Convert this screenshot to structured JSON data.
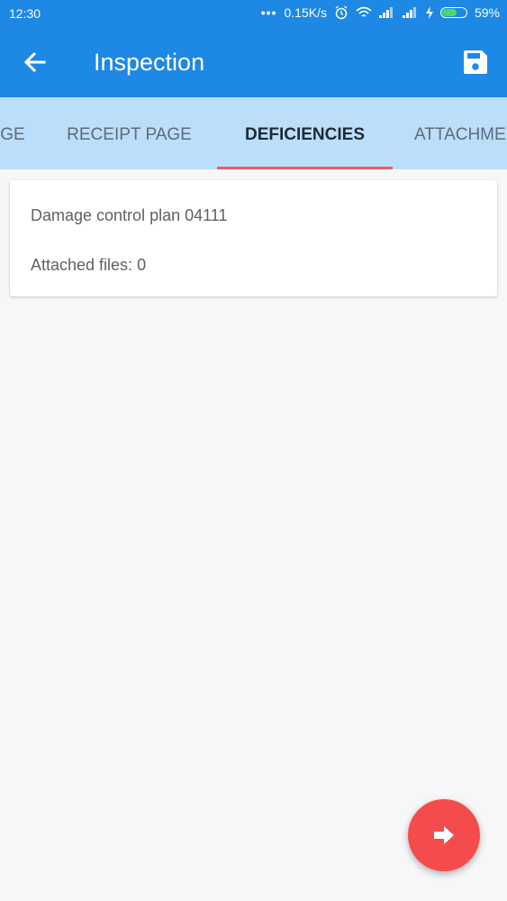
{
  "status_bar": {
    "time": "12:30",
    "network_speed": "0.15K/s",
    "battery_percent": "59%",
    "battery_level": 0.59,
    "icons": [
      "more-dots-icon",
      "alarm-icon",
      "wifi-icon",
      "signal-icon",
      "signal-icon",
      "charging-icon",
      "battery-icon"
    ]
  },
  "app_bar": {
    "title": "Inspection",
    "back_icon": "arrow-left-icon",
    "save_icon": "floppy-disk-icon"
  },
  "tabs": [
    {
      "label": "GE",
      "active": false
    },
    {
      "label": "RECEIPT PAGE",
      "active": false
    },
    {
      "label": "DEFICIENCIES",
      "active": true
    },
    {
      "label": "ATTACHME",
      "active": false
    }
  ],
  "card": {
    "title": "Damage control plan 04111",
    "attached_files": "Attached files: 0"
  },
  "fab": {
    "icon": "arrow-right-icon"
  },
  "colors": {
    "primary": "#1e88e5",
    "tab_bar": "#bbdefb",
    "accent": "#f44c4c",
    "indicator": "#f05a5a"
  }
}
